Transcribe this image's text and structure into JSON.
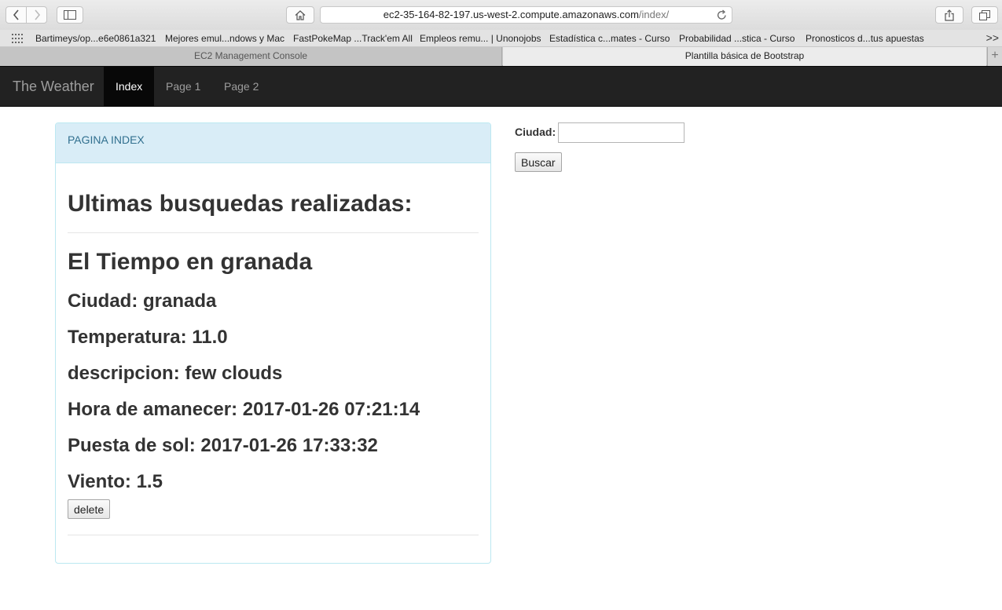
{
  "browser": {
    "url_host": "ec2-35-164-82-197.us-west-2.compute.amazonaws.com",
    "url_path": "/index/",
    "bookmarks": [
      "Bartimeys/op...e6e0861a321",
      "Mejores emul...ndows y Mac",
      "FastPokeMap ...Track'em All",
      "Empleos remu... | Unonojobs",
      "Estadística c...mates - Curso",
      "Probabilidad ...stica - Curso",
      "Pronosticos d...tus apuestas"
    ],
    "bookmarks_more": ">>",
    "tabs": [
      "EC2 Management Console",
      "Plantilla básica de Bootstrap"
    ],
    "new_tab_symbol": "+"
  },
  "navbar": {
    "brand": "The Weather",
    "items": [
      {
        "label": "Index",
        "active": true
      },
      {
        "label": "Page 1",
        "active": false
      },
      {
        "label": "Page 2",
        "active": false
      }
    ]
  },
  "panel": {
    "heading": "PAGINA INDEX",
    "title": "Ultimas busquedas realizadas:",
    "entry": {
      "heading": "El Tiempo en granada",
      "city": "Ciudad: granada",
      "temperature": "Temperatura: 11.0",
      "description": "descripcion: few clouds",
      "sunrise": "Hora de amanecer: 2017-01-26 07:21:14",
      "sunset": "Puesta de sol: 2017-01-26 17:33:32",
      "wind": "Viento: 1.5",
      "delete_label": "delete"
    }
  },
  "search": {
    "label": "Ciudad:",
    "value": "",
    "button_label": "Buscar"
  },
  "colors": {
    "navbar_bg": "#222222",
    "panel_heading_bg": "#d9edf7",
    "panel_heading_text": "#31708f",
    "panel_border": "#bce8f1"
  }
}
